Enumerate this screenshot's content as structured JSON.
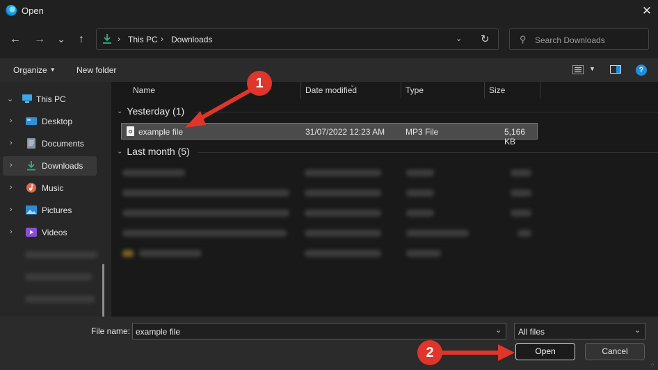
{
  "window": {
    "title": "Open",
    "close_glyph": "✕"
  },
  "nav": {
    "back_glyph": "←",
    "forward_glyph": "→",
    "recent_glyph": "⌄",
    "up_glyph": "↑"
  },
  "address": {
    "crumbs": [
      "This PC",
      "Downloads"
    ],
    "separator_glyph": "›",
    "dropdown_glyph": "⌄",
    "refresh_glyph": "↻"
  },
  "search": {
    "placeholder": "Search Downloads"
  },
  "commandbar": {
    "organize_label": "Organize",
    "new_folder_label": "New folder",
    "help_glyph": "?"
  },
  "sidebar": {
    "items": [
      {
        "label": "This PC",
        "icon": "monitor-icon"
      },
      {
        "label": "Desktop",
        "icon": "desktop-icon"
      },
      {
        "label": "Documents",
        "icon": "documents-icon"
      },
      {
        "label": "Downloads",
        "icon": "download-icon"
      },
      {
        "label": "Music",
        "icon": "music-icon"
      },
      {
        "label": "Pictures",
        "icon": "pictures-icon"
      },
      {
        "label": "Videos",
        "icon": "videos-icon"
      }
    ]
  },
  "columns": {
    "name": "Name",
    "date": "Date modified",
    "type": "Type",
    "size": "Size"
  },
  "groups": [
    {
      "label": "Yesterday (1)"
    },
    {
      "label": "Last month (5)"
    }
  ],
  "files": [
    {
      "name": "example file",
      "date": "31/07/2022 12:23 AM",
      "type": "MP3 File",
      "size": "5,166 KB"
    }
  ],
  "footer": {
    "filename_label": "File name:",
    "filename_value": "example file",
    "filetype_value": "All files",
    "open_label": "Open",
    "cancel_label": "Cancel"
  },
  "annotations": {
    "step1": "1",
    "step2": "2",
    "color": "#e0352b"
  },
  "colors": {
    "background": "#202020",
    "selection": "#4b4b4b",
    "accent": "#1e8fe0"
  }
}
